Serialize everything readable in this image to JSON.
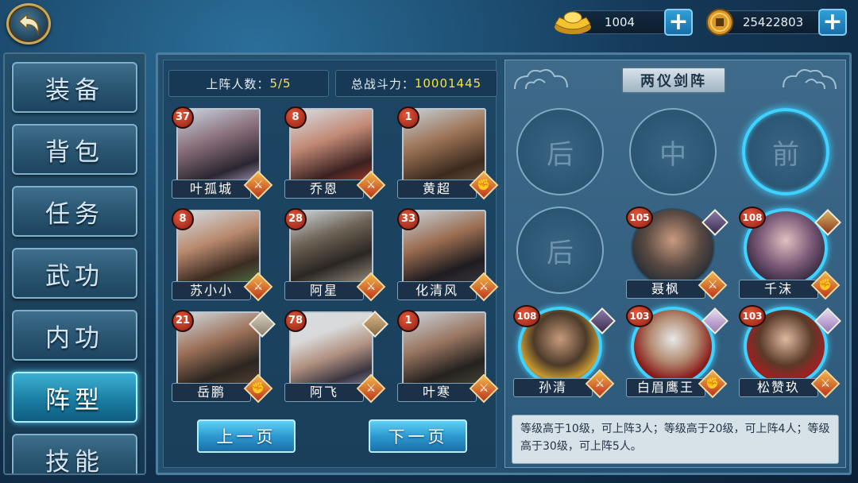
{
  "currency": {
    "ingot": {
      "value": "1004",
      "icon": "gold-ingot-icon"
    },
    "coin": {
      "value": "25422803",
      "icon": "copper-coin-icon"
    },
    "plus_label": "+"
  },
  "menu": [
    {
      "label": "装备",
      "active": false
    },
    {
      "label": "背包",
      "active": false
    },
    {
      "label": "任务",
      "active": false
    },
    {
      "label": "武功",
      "active": false
    },
    {
      "label": "内功",
      "active": false
    },
    {
      "label": "阵型",
      "active": true
    },
    {
      "label": "技能",
      "active": false
    }
  ],
  "roster": {
    "deploy_label": "上阵人数：",
    "deploy_value": "5/5",
    "power_label": "总战斗力：",
    "power_value": "10001445",
    "heroes": [
      {
        "name": "叶孤城",
        "level": "37",
        "class": "sword",
        "element": ""
      },
      {
        "name": "乔恩",
        "level": "8",
        "class": "sword",
        "element": ""
      },
      {
        "name": "黄超",
        "level": "1",
        "class": "fist",
        "element": ""
      },
      {
        "name": "苏小小",
        "level": "8",
        "class": "sword",
        "element": ""
      },
      {
        "name": "阿星",
        "level": "28",
        "class": "sword",
        "element": ""
      },
      {
        "name": "化清风",
        "level": "33",
        "class": "sword",
        "element": ""
      },
      {
        "name": "岳鹏",
        "level": "21",
        "class": "fist",
        "element": "beast"
      },
      {
        "name": "阿飞",
        "level": "78",
        "class": "sword",
        "element": "beast"
      },
      {
        "name": "叶寒",
        "level": "1",
        "class": "sword",
        "element": ""
      }
    ],
    "prev_page": "上一页",
    "next_page": "下一页"
  },
  "formation": {
    "title": "两仪剑阵",
    "empty_slots": [
      {
        "label": "后",
        "glow": false
      },
      {
        "label": "中",
        "glow": false
      },
      {
        "label": "前",
        "glow": true
      },
      {
        "label": "后",
        "glow": false
      }
    ],
    "placed": [
      {
        "name": "聂枫",
        "level": "105",
        "class": "sword"
      },
      {
        "name": "千沫",
        "level": "108",
        "class": "fist"
      },
      {
        "name": "孙清",
        "level": "108",
        "class": "sword"
      },
      {
        "name": "白眉鹰王",
        "level": "103",
        "class": "fist"
      },
      {
        "name": "松赞玖",
        "level": "103",
        "class": "sword"
      }
    ],
    "rule": "等级高于10级，可上阵3人；等级高于20级，可上阵4人；等级高于30级，可上阵5人。"
  },
  "colors": {
    "accent": "#3fd1ff",
    "value_yellow": "#f3e24b",
    "badge_red": "#c23a22"
  }
}
